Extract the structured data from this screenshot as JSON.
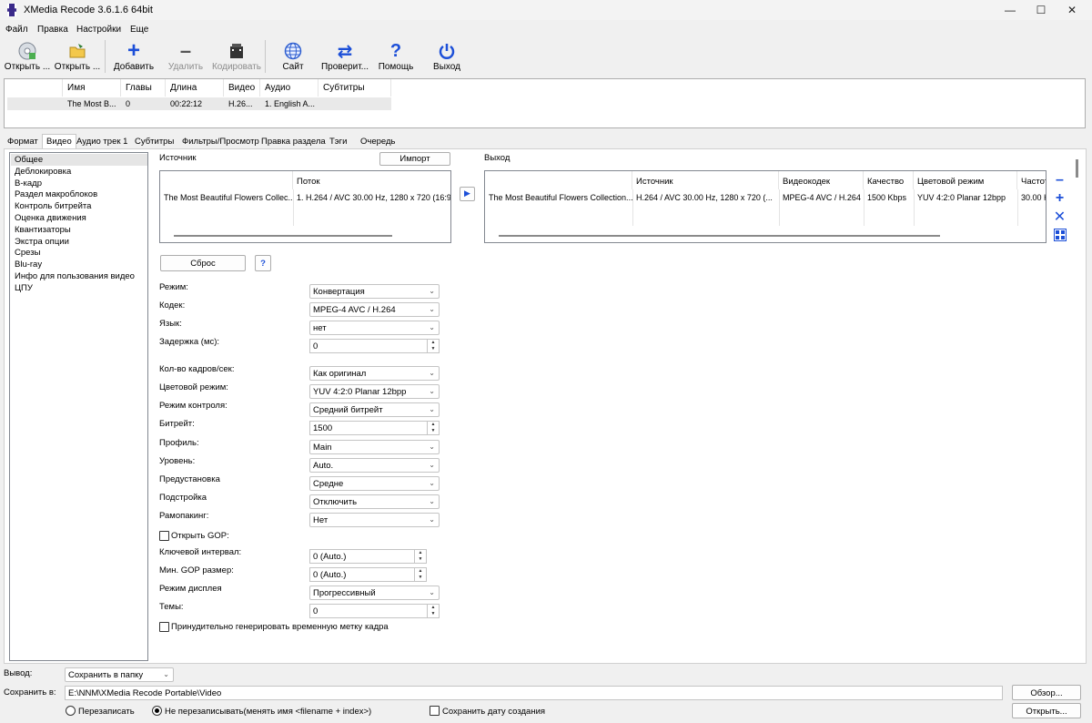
{
  "window": {
    "title": "XMedia Recode 3.6.1.6 64bit"
  },
  "menu": [
    "Файл",
    "Правка",
    "Настройки",
    "Еще"
  ],
  "toolbar": [
    {
      "label": "Открыть ...",
      "icon": "disc-icon",
      "enabled": true
    },
    {
      "label": "Открыть ...",
      "icon": "folder-open-icon",
      "enabled": true
    },
    {
      "label": "Добавить",
      "icon": "plus-icon",
      "enabled": true
    },
    {
      "label": "Удалить",
      "icon": "minus-icon",
      "enabled": false
    },
    {
      "label": "Кодировать",
      "icon": "film-icon",
      "enabled": false
    },
    {
      "label": "Сайт",
      "icon": "globe-icon",
      "enabled": true
    },
    {
      "label": "Проверит...",
      "icon": "refresh-icon",
      "enabled": true
    },
    {
      "label": "Помощь",
      "icon": "help-icon",
      "enabled": true
    },
    {
      "label": "Выход",
      "icon": "power-icon",
      "enabled": true
    }
  ],
  "file_table": {
    "headers": [
      "Имя",
      "Главы",
      "Длина",
      "Видео",
      "Аудио",
      "Субтитры"
    ],
    "rows": [
      [
        "The Most B...",
        "0",
        "00:22:12",
        "H.26...",
        "1. English A...",
        ""
      ]
    ]
  },
  "tabs": [
    "Формат",
    "Видео",
    "Аудио трек 1",
    "Субтитры",
    "Фильтры/Просмотр",
    "Правка раздела",
    "Тэги",
    "Очередь"
  ],
  "active_tab": "Видео",
  "categories": [
    "Общее",
    "Деблокировка",
    "В-кадр",
    "Раздел макроблоков",
    "Контроль битрейта",
    "Оценка движения",
    "Квантизаторы",
    "Экстра опции",
    "Срезы",
    "Blu-ray",
    "Инфо для пользования видео",
    "ЦПУ"
  ],
  "selected_category": "Общее",
  "source": {
    "label": "Источник",
    "import_button": "Импорт",
    "headers": [
      "",
      "Поток"
    ],
    "row": [
      "The Most Beautiful Flowers Collec...",
      "1. H.264 / AVC  30.00 Hz, 1280 x 720 (16:9"
    ]
  },
  "output": {
    "label": "Выход",
    "headers": [
      "",
      "Источник",
      "Видеокодек",
      "Качество",
      "Цветовой режим",
      "Частот"
    ],
    "row": [
      "The Most Beautiful Flowers Collection...",
      "H.264 / AVC  30.00 Hz, 1280 x 720 (...",
      "MPEG-4 AVC / H.264",
      "1500 Kbps",
      "YUV 4:2:0 Planar 12bpp",
      "30.00 H"
    ]
  },
  "reset_button": "Сброс",
  "help_button": "?",
  "form": [
    {
      "label": "Режим:",
      "type": "combo",
      "value": "Конвертация"
    },
    {
      "label": "Кодек:",
      "type": "combo",
      "value": "MPEG-4 AVC / H.264"
    },
    {
      "label": "Язык:",
      "type": "combo",
      "value": "нет"
    },
    {
      "label": "Задержка (мс):",
      "type": "spin",
      "value": "0"
    },
    {
      "label": "Кол-во кадров/сек:",
      "type": "combo",
      "value": "Как оригинал"
    },
    {
      "label": "Цветовой режим:",
      "type": "combo",
      "value": "YUV 4:2:0 Planar 12bpp"
    },
    {
      "label": "Режим контроля:",
      "type": "combo",
      "value": "Средний битрейт"
    },
    {
      "label": "Битрейт:",
      "type": "spin",
      "value": "1500"
    },
    {
      "label": "Профиль:",
      "type": "combo",
      "value": "Main"
    },
    {
      "label": "Уровень:",
      "type": "combo",
      "value": "Auto."
    },
    {
      "label": "Предустановка",
      "type": "combo",
      "value": "Средне"
    },
    {
      "label": "Подстройка",
      "type": "combo",
      "value": "Отключить"
    },
    {
      "label": "Рамопакинг:",
      "type": "combo",
      "value": "Нет"
    },
    {
      "label": "Открыть GOP:",
      "type": "checkbox",
      "checked": false
    },
    {
      "label": "Ключевой интервал:",
      "type": "spin-narrow",
      "value": "0 (Auto.)"
    },
    {
      "label": "Мин. GOP размер:",
      "type": "spin-narrow",
      "value": "0 (Auto.)"
    },
    {
      "label": "Режим дисплея",
      "type": "combo",
      "value": "Прогрессивный"
    },
    {
      "label": "Темы:",
      "type": "spin",
      "value": "0"
    },
    {
      "label": "Принудительно генерировать временную метку кадра",
      "type": "checkbox",
      "checked": false
    }
  ],
  "bottom": {
    "output_label": "Вывод:",
    "output_value": "Сохранить в папку",
    "save_label": "Сохранить в:",
    "save_path": "E:\\NNM\\XMedia Recode Portable\\Video",
    "browse_button": "Обзор...",
    "open_button": "Открыть...",
    "radio_overwrite": "Перезаписать",
    "radio_no_overwrite": "Не перезаписывать(менять имя <filename + index>)",
    "keep_date": "Сохранить дату создания"
  }
}
